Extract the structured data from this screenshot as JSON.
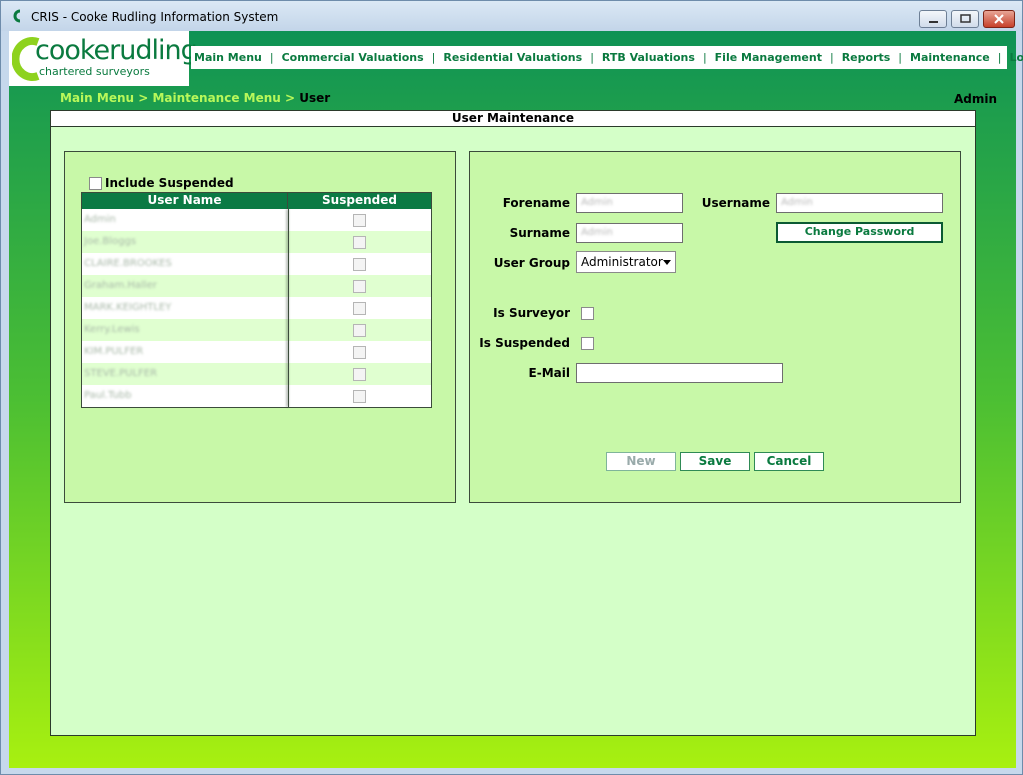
{
  "window": {
    "title": "CRIS - Cooke Rudling Information System"
  },
  "logo": {
    "brand_a": "cooke",
    "brand_b": "rudling",
    "tagline": "chartered surveyors"
  },
  "nav": [
    "Main Menu",
    "Commercial Valuations",
    "Residential Valuations",
    "RTB Valuations",
    "File Management",
    "Reports",
    "Maintenance",
    "Log Off"
  ],
  "breadcrumb": {
    "main": "Main Menu",
    "sep1": " > ",
    "maint": "Maintenance Menu",
    "sep2": " > ",
    "current": "User"
  },
  "current_user": "Admin",
  "panel_title": "User Maintenance",
  "user_list": {
    "include_suspended_label": "Include Suspended",
    "col_username": "User Name",
    "col_suspended": "Suspended",
    "rows": [
      {
        "name": "Admin"
      },
      {
        "name": "Joe.Bloggs"
      },
      {
        "name": "CLAIRE.BROOKES"
      },
      {
        "name": "Graham.Haller"
      },
      {
        "name": "MARK.KEIGHTLEY"
      },
      {
        "name": "Kerry.Lewis"
      },
      {
        "name": "KIM.PULFER"
      },
      {
        "name": "STEVE.PULFER"
      },
      {
        "name": "Paul.Tubb"
      }
    ]
  },
  "form": {
    "forename_label": "Forename",
    "forename_value": "Admin",
    "username_label": "Username",
    "username_value": "Admin",
    "surname_label": "Surname",
    "surname_value": "Admin",
    "change_password": "Change Password",
    "group_label": "User Group",
    "group_value": "Administrator",
    "surveyor_label": "Is Surveyor",
    "suspended_label": "Is Suspended",
    "email_label": "E-Mail",
    "email_value": ""
  },
  "buttons": {
    "new": "New",
    "save": "Save",
    "cancel": "Cancel"
  },
  "colors": {
    "brand_green": "#0a7a3f",
    "grid_header": "#0b7a44",
    "panel_bg": "#d4ffc8",
    "box_bg": "#c8f8a8"
  }
}
